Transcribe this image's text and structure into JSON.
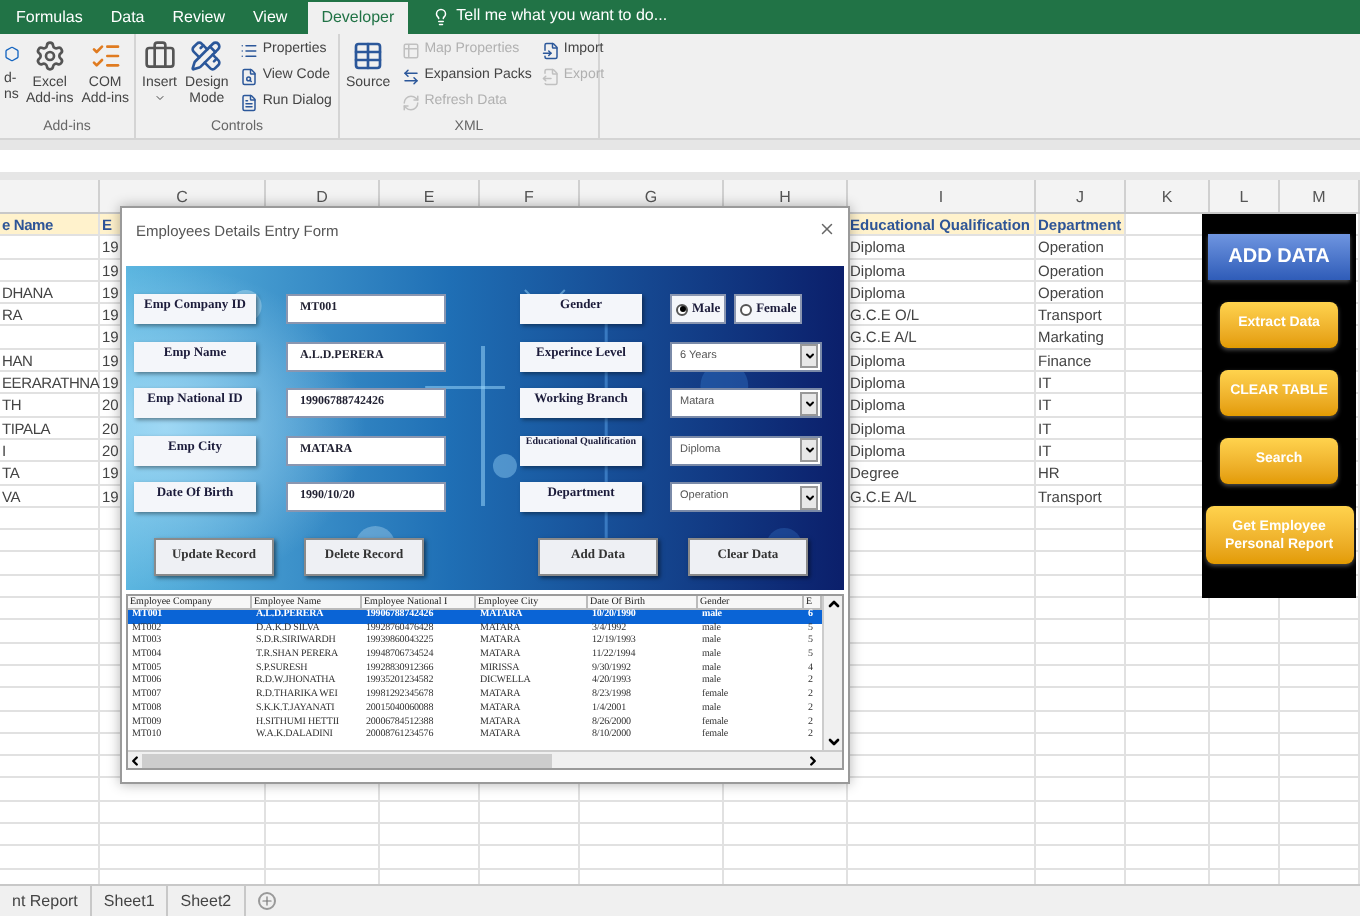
{
  "ribbon": {
    "tabs": [
      {
        "label": "Formulas",
        "selected": false
      },
      {
        "label": "Data",
        "selected": false
      },
      {
        "label": "Review",
        "selected": false
      },
      {
        "label": "View",
        "selected": false
      },
      {
        "label": "Developer",
        "selected": true
      }
    ],
    "tell_me": "Tell me what you want to do...",
    "groups": [
      {
        "label": "Add-ins",
        "large": [
          {
            "lines": [
              "d-",
              "ns"
            ],
            "has_menu": false
          },
          {
            "lines": [
              "Excel",
              "Add-ins"
            ],
            "has_menu": false
          },
          {
            "lines": [
              "COM",
              "Add-ins"
            ],
            "has_menu": false
          }
        ]
      },
      {
        "label": "Controls",
        "large": [
          {
            "lines": [
              "Insert"
            ],
            "has_menu": true
          },
          {
            "lines": [
              "Design",
              "Mode"
            ],
            "has_menu": false
          }
        ],
        "small_columns": [
          [
            {
              "label": "Properties",
              "disabled": false
            },
            {
              "label": "View Code",
              "disabled": false
            },
            {
              "label": "Run Dialog",
              "disabled": false
            }
          ]
        ]
      },
      {
        "label": "XML",
        "large": [
          {
            "lines": [
              "Source"
            ],
            "has_menu": false
          }
        ],
        "small_columns": [
          [
            {
              "label": "Map Properties",
              "disabled": true
            },
            {
              "label": "Expansion Packs",
              "disabled": false
            },
            {
              "label": "Refresh Data",
              "disabled": true
            }
          ],
          [
            {
              "label": "Import",
              "disabled": false
            },
            {
              "label": "Export",
              "disabled": true
            }
          ]
        ]
      }
    ]
  },
  "sheet": {
    "column_headers": [
      "C",
      "D",
      "E",
      "F",
      "G",
      "H",
      "I",
      "J",
      "K",
      "L",
      "M"
    ],
    "header_row": {
      "column_a": "e Name",
      "column_c": "E",
      "column_i": "Educational Qualification",
      "column_j": "Department"
    },
    "rows": [
      {
        "column_a": "",
        "column_c": "19",
        "column_i": "Diploma",
        "column_j": "Operation"
      },
      {
        "column_a": "",
        "column_c": "19",
        "column_i": "Diploma",
        "column_j": "Operation"
      },
      {
        "column_a": "DHANA",
        "column_c": "19",
        "column_i": "Diploma",
        "column_j": "Operation"
      },
      {
        "column_a": "RA",
        "column_c": "19",
        "column_i": "G.C.E O/L",
        "column_j": "Transport"
      },
      {
        "column_a": "",
        "column_c": "19",
        "column_i": "G.C.E A/L",
        "column_j": "Markating"
      },
      {
        "column_a": "HAN",
        "column_c": "19",
        "column_i": "Diploma",
        "column_j": "Finance"
      },
      {
        "column_a": "EERARATHNA",
        "column_c": "19",
        "column_i": "Diploma",
        "column_j": "IT"
      },
      {
        "column_a": "TH",
        "column_c": "20",
        "column_i": "Diploma",
        "column_j": "IT"
      },
      {
        "column_a": "TIPALA",
        "column_c": "20",
        "column_i": "Diploma",
        "column_j": "IT"
      },
      {
        "column_a": "I",
        "column_c": "20",
        "column_i": "Diploma",
        "column_j": "IT"
      },
      {
        "column_a": "TA",
        "column_c": "19",
        "column_i": "Degree",
        "column_j": "HR"
      },
      {
        "column_a": "VA",
        "column_c": "19",
        "column_i": "G.C.E A/L",
        "column_j": "Transport"
      }
    ],
    "sheet_tabs": [
      "nt Report",
      "Sheet1",
      "Sheet2"
    ]
  },
  "macro_panel": {
    "buttons": [
      {
        "label": "ADD DATA",
        "kind": "blue"
      },
      {
        "label": "Extract Data",
        "kind": "gold"
      },
      {
        "label": "CLEAR TABLE",
        "kind": "gold"
      },
      {
        "label": "Search",
        "kind": "gold"
      },
      {
        "label": "Get Employee Personal Report",
        "kind": "gold"
      }
    ]
  },
  "dialog": {
    "title": "Employees Details Entry Form",
    "left_fields": [
      {
        "label": "Emp Company ID",
        "value": "MT001"
      },
      {
        "label": "Emp Name",
        "value": "A.L.D.PERERA"
      },
      {
        "label": "Emp National ID",
        "value": "19906788742426"
      },
      {
        "label": "Emp City",
        "value": "MATARA"
      },
      {
        "label": "Date Of Birth",
        "value": "1990/10/20"
      }
    ],
    "right_fields": [
      {
        "label": "Gender",
        "kind": "radio",
        "options": [
          {
            "label": "Male",
            "selected": true
          },
          {
            "label": "Female",
            "selected": false
          }
        ]
      },
      {
        "label": "Experince Level",
        "kind": "dropdown",
        "value": "6 Years"
      },
      {
        "label": "Working Branch",
        "kind": "dropdown",
        "value": "Matara"
      },
      {
        "label": "Educational Qualification",
        "kind": "dropdown",
        "value": "Diploma"
      },
      {
        "label": "Department",
        "kind": "dropdown",
        "value": "Operation"
      }
    ],
    "buttons": [
      "Update Record",
      "Delete Record",
      "Add Data",
      "Clear Data"
    ],
    "list": {
      "columns": [
        "Employee Company",
        "Employee Name",
        "Employee National I",
        "Employee City",
        "Date Of Birth",
        "Gender",
        "E"
      ],
      "rows": [
        {
          "cells": [
            "MT001",
            "A.L.D.PERERA",
            "19906788742426",
            "MATARA",
            "10/20/1990",
            "male",
            "6"
          ],
          "selected": true
        },
        {
          "cells": [
            "MT002",
            "D.A.K.D SILVA",
            "19928760476428",
            "MATARA",
            "3/4/1992",
            "male",
            "5"
          ],
          "selected": false
        },
        {
          "cells": [
            "MT003",
            "S.D.R.SIRIWARDH",
            "19939860043225",
            "MATARA",
            "12/19/1993",
            "male",
            "5"
          ],
          "selected": false
        },
        {
          "cells": [
            "MT004",
            "T.R.SHAN PERERA",
            "19948706734524",
            "MATARA",
            "11/22/1994",
            "male",
            "5"
          ],
          "selected": false
        },
        {
          "cells": [
            "MT005",
            "S.P.SURESH",
            "19928830912366",
            "MIRISSA",
            "9/30/1992",
            "male",
            "4"
          ],
          "selected": false
        },
        {
          "cells": [
            "MT006",
            "R.D.W.JHONATHA",
            "19935201234582",
            "DICWELLA",
            "4/20/1993",
            "male",
            "2"
          ],
          "selected": false
        },
        {
          "cells": [
            "MT007",
            "R.D.THARIKA WEI",
            "19981292345678",
            "MATARA",
            "8/23/1998",
            "female",
            "2"
          ],
          "selected": false
        },
        {
          "cells": [
            "MT008",
            "S.K.K.T.JAYANATI",
            "20015040060088",
            "MATARA",
            "1/4/2001",
            "male",
            "2"
          ],
          "selected": false
        },
        {
          "cells": [
            "MT009",
            "H.SITHUMI HETTII",
            "20006784512388",
            "MATARA",
            "8/26/2000",
            "female",
            "2"
          ],
          "selected": false
        },
        {
          "cells": [
            "MT010",
            "W.A.K.DALADINI",
            "20008761234576",
            "MATARA",
            "8/10/2000",
            "female",
            "2"
          ],
          "selected": false
        }
      ]
    }
  }
}
